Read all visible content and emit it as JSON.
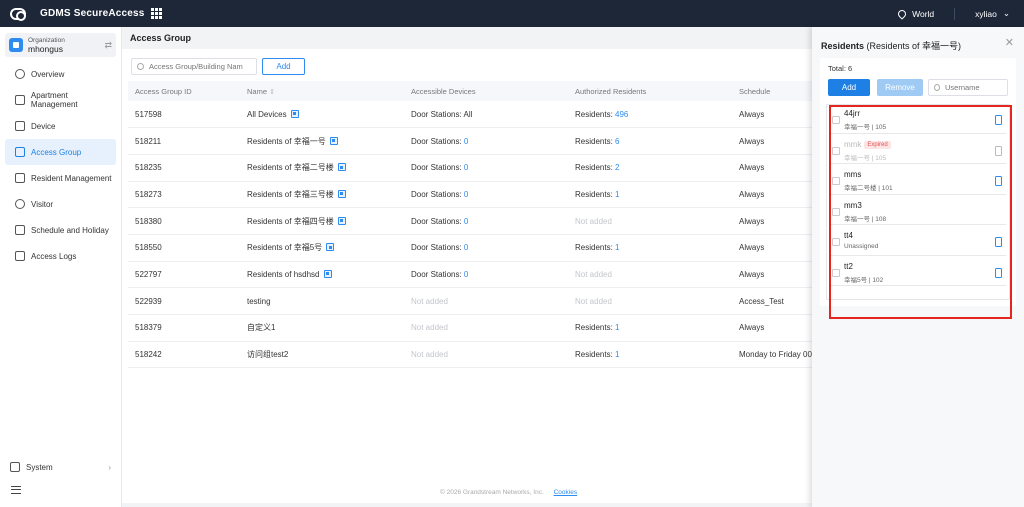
{
  "app": {
    "title": "GDMS SecureAccess",
    "region": "World",
    "user": "xyliao"
  },
  "sidebar": {
    "org_label": "Organization",
    "org_name": "mhongus",
    "items": [
      {
        "label": "Overview",
        "icon": "pie-chart-icon"
      },
      {
        "label": "Apartment Management",
        "icon": "building-icon"
      },
      {
        "label": "Device",
        "icon": "device-icon"
      },
      {
        "label": "Access Group",
        "icon": "access-group-icon"
      },
      {
        "label": "Resident Management",
        "icon": "person-icon"
      },
      {
        "label": "Visitor",
        "icon": "visitor-icon"
      },
      {
        "label": "Schedule and Holiday",
        "icon": "calendar-icon"
      },
      {
        "label": "Access Logs",
        "icon": "log-icon"
      }
    ],
    "system_label": "System"
  },
  "main": {
    "title": "Access Group",
    "search_placeholder": "Access Group/Building Nam",
    "add_label": "Add",
    "columns": [
      "Access Group ID",
      "Name",
      "Accessible Devices",
      "Authorized Residents",
      "Schedule"
    ],
    "rows": [
      {
        "id": "517598",
        "name": "All Devices",
        "devices_prefix": "Door Stations: ",
        "devices_value": "All",
        "residents_prefix": "Residents: ",
        "residents_value": "496",
        "schedule": "Always"
      },
      {
        "id": "518211",
        "name": "Residents of 幸福一号",
        "devices_prefix": "Door Stations: ",
        "devices_value": "0",
        "residents_prefix": "Residents: ",
        "residents_value": "6",
        "schedule": "Always"
      },
      {
        "id": "518235",
        "name": "Residents of 幸福二号楼",
        "devices_prefix": "Door Stations: ",
        "devices_value": "0",
        "residents_prefix": "Residents: ",
        "residents_value": "2",
        "schedule": "Always"
      },
      {
        "id": "518273",
        "name": "Residents of 幸福三号楼",
        "devices_prefix": "Door Stations: ",
        "devices_value": "0",
        "residents_prefix": "Residents: ",
        "residents_value": "1",
        "schedule": "Always"
      },
      {
        "id": "518380",
        "name": "Residents of 幸福四号楼",
        "devices_prefix": "Door Stations: ",
        "devices_value": "0",
        "residents_prefix": "",
        "residents_value": "Not added",
        "schedule": "Always"
      },
      {
        "id": "518550",
        "name": "Residents of 幸福5号",
        "devices_prefix": "Door Stations: ",
        "devices_value": "0",
        "residents_prefix": "Residents: ",
        "residents_value": "1",
        "schedule": "Always"
      },
      {
        "id": "522797",
        "name": "Residents of hsdhsd",
        "devices_prefix": "Door Stations: ",
        "devices_value": "0",
        "residents_prefix": "",
        "residents_value": "Not added",
        "schedule": "Always"
      },
      {
        "id": "522939",
        "name": "testing",
        "devices_prefix": "",
        "devices_value": "Not added",
        "residents_prefix": "",
        "residents_value": "Not added",
        "schedule": "Access_Test"
      },
      {
        "id": "518379",
        "name": "自定义1",
        "devices_prefix": "",
        "devices_value": "Not added",
        "residents_prefix": "Residents: ",
        "residents_value": "1",
        "schedule": "Always"
      },
      {
        "id": "518242",
        "name": "访问组test2",
        "devices_prefix": "",
        "devices_value": "Not added",
        "residents_prefix": "Residents: ",
        "residents_value": "1",
        "schedule": "Monday to Friday 00"
      }
    ],
    "footer": "© 2026 Grandstream Networks, Inc.",
    "footer_link": "Cookies"
  },
  "panel": {
    "title_bold": "Residents",
    "title_rest": " (Residents of 幸福一号)",
    "total": "Total: 6",
    "add_label": "Add",
    "remove_label": "Remove",
    "search_placeholder": "Username",
    "residents": [
      {
        "name": "44jrr",
        "sub": "幸福一号 | 105",
        "phone": true,
        "disabled": false,
        "badge": ""
      },
      {
        "name": "mmk",
        "sub": "幸福一号 | 105",
        "phone": true,
        "disabled": true,
        "badge": "Expired"
      },
      {
        "name": "mms",
        "sub": "幸福二号楼 | 101",
        "phone": true,
        "disabled": false,
        "badge": ""
      },
      {
        "name": "mm3",
        "sub": "幸福一号 | 108",
        "phone": false,
        "disabled": false,
        "badge": ""
      },
      {
        "name": "tt4",
        "sub": "Unassigned",
        "phone": true,
        "disabled": false,
        "badge": ""
      },
      {
        "name": "tt2",
        "sub": "幸福5号 | 102",
        "phone": true,
        "disabled": false,
        "badge": ""
      }
    ]
  },
  "colors": {
    "accent": "#1e80e4",
    "topbar": "#1d2738",
    "highlight": "#e5261e"
  }
}
